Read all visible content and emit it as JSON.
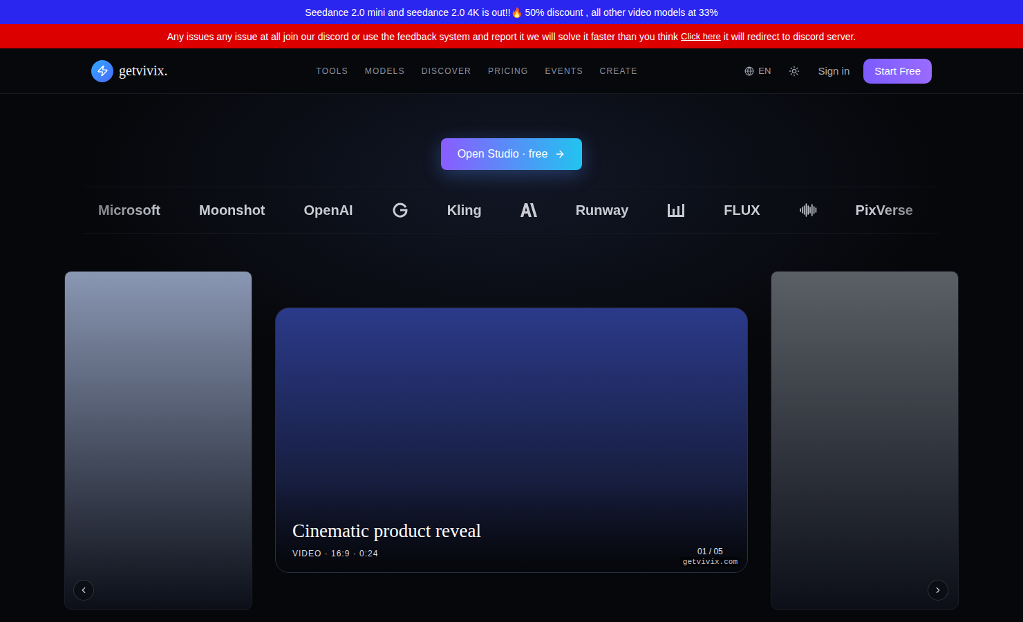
{
  "announcement": {
    "text": "Seedance 2.0 mini and seedance 2.0 4K is out!!🔥 50% discount , all other video models at 33%"
  },
  "notice": {
    "text": "Any issues any issue at all join our discord or use the feedback system and report it we will solve it faster than you think",
    "link": "Click here",
    "suffix": "it will redirect to discord server."
  },
  "nav": {
    "brand": "getvivix.",
    "links": [
      {
        "label": "TOOLS",
        "selected": false
      },
      {
        "label": "MODELS",
        "selected": false
      },
      {
        "label": "DISCOVER",
        "selected": false
      },
      {
        "label": "PRICING",
        "selected": false
      },
      {
        "label": "EVENTS",
        "selected": false
      },
      {
        "label": "CREATE",
        "selected": false
      }
    ],
    "language": "EN",
    "sign_in": "Sign in",
    "cta": "Start Free"
  },
  "hero": {
    "cta": "Open Studio · free"
  },
  "logos": [
    {
      "kind": "wordmark",
      "label": "Microsoft"
    },
    {
      "kind": "wordmark",
      "label": "Moonshot"
    },
    {
      "kind": "wordmark",
      "label": "OpenAI"
    },
    {
      "kind": "mark"
    },
    {
      "kind": "wordmark",
      "label": "Kling"
    },
    {
      "kind": "mark"
    },
    {
      "kind": "wordmark",
      "label": "Runway"
    },
    {
      "kind": "mark"
    },
    {
      "kind": "wordmark",
      "label": "FLUX"
    },
    {
      "kind": "mark"
    },
    {
      "kind": "wordmark",
      "label": "PixVerse"
    },
    {
      "kind": "mark"
    }
  ],
  "carousel": {
    "slides": [
      {
        "selected": false,
        "color": "#8a97b3"
      },
      {
        "selected": true,
        "color": "#2b3a8a",
        "title": "Cinematic product reveal",
        "meta": "VIDEO · 16:9 · 0:24",
        "counter": "01 / 05",
        "watermark": "getvivix.com"
      },
      {
        "selected": false,
        "color": "#5b5f66"
      }
    ]
  }
}
